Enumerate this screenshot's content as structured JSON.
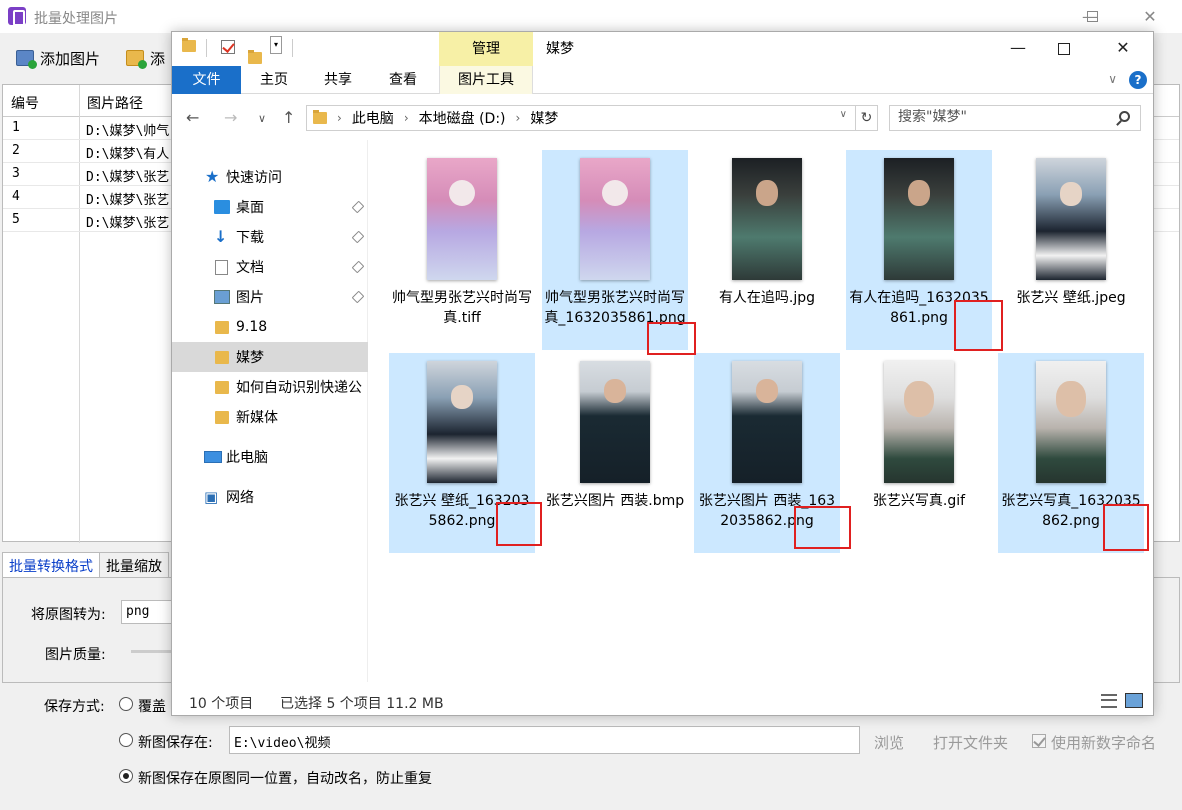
{
  "bg_app": {
    "title": "批量处理图片",
    "toolbar": {
      "add_image": "添加图片",
      "add_folder": "添"
    },
    "table": {
      "headers": [
        "编号",
        "图片路径"
      ],
      "rows": [
        {
          "num": "1",
          "path": "D:\\媒梦\\帅气"
        },
        {
          "num": "2",
          "path": "D:\\媒梦\\有人"
        },
        {
          "num": "3",
          "path": "D:\\媒梦\\张艺"
        },
        {
          "num": "4",
          "path": "D:\\媒梦\\张艺"
        },
        {
          "num": "5",
          "path": "D:\\媒梦\\张艺"
        }
      ]
    },
    "tabs": [
      "批量转换格式",
      "批量缩放"
    ],
    "convert_label": "将原图转为:",
    "convert_value": "png",
    "quality_label": "图片质量:",
    "save_method_label": "保存方式:",
    "option_overwrite": "覆盖",
    "option_new_path": "新图保存在:",
    "new_path_value": "E:\\video\\视频",
    "browse": "浏览",
    "open_folder": "打开文件夹",
    "numeric_rename": "使用新数字命名",
    "option_same_location": "新图保存在原图同一位置，自动改名，防止重复"
  },
  "explorer": {
    "context_tab": "管理",
    "window_title": "媒梦",
    "ribbon_tabs": [
      "文件",
      "主页",
      "共享",
      "查看",
      "图片工具"
    ],
    "help": "?",
    "breadcrumbs": [
      "此电脑",
      "本地磁盘 (D:)",
      "媒梦"
    ],
    "search_placeholder": "搜索\"媒梦\"",
    "nav_items": [
      {
        "label": "快速访问",
        "icon": "star-icon"
      },
      {
        "label": "桌面",
        "icon": "desktop-icon",
        "pinned": true
      },
      {
        "label": "下载",
        "icon": "download-icon",
        "pinned": true
      },
      {
        "label": "文档",
        "icon": "document-icon",
        "pinned": true
      },
      {
        "label": "图片",
        "icon": "pictures-icon",
        "pinned": true
      },
      {
        "label": "9.18",
        "icon": "folder-icon"
      },
      {
        "label": "媒梦",
        "icon": "folder-icon",
        "selected": true
      },
      {
        "label": "如何自动识别快递公",
        "icon": "folder-icon"
      },
      {
        "label": "新媒体",
        "icon": "folder-icon"
      },
      {
        "label": "此电脑",
        "icon": "computer-icon"
      },
      {
        "label": "网络",
        "icon": "network-icon"
      }
    ],
    "files": [
      {
        "name": "帅气型男张艺兴时尚写真.tiff",
        "selected": false
      },
      {
        "name": "帅气型男张艺兴时尚写真_1632035861.png",
        "selected": true
      },
      {
        "name": "有人在追吗.jpg",
        "selected": false
      },
      {
        "name": "有人在追吗_1632035861.png",
        "selected": true
      },
      {
        "name": "张艺兴 壁纸.jpeg",
        "selected": false
      },
      {
        "name": "张艺兴 壁纸_1632035862.png",
        "selected": true
      },
      {
        "name": "张艺兴图片 西装.bmp",
        "selected": false
      },
      {
        "name": "张艺兴图片 西装_1632035862.png",
        "selected": true
      },
      {
        "name": "张艺兴写真.gif",
        "selected": false
      },
      {
        "name": "张艺兴写真_1632035862.png",
        "selected": true
      }
    ],
    "status": {
      "item_count": "10 个项目",
      "selected": "已选择 5 个项目  11.2 MB"
    }
  }
}
